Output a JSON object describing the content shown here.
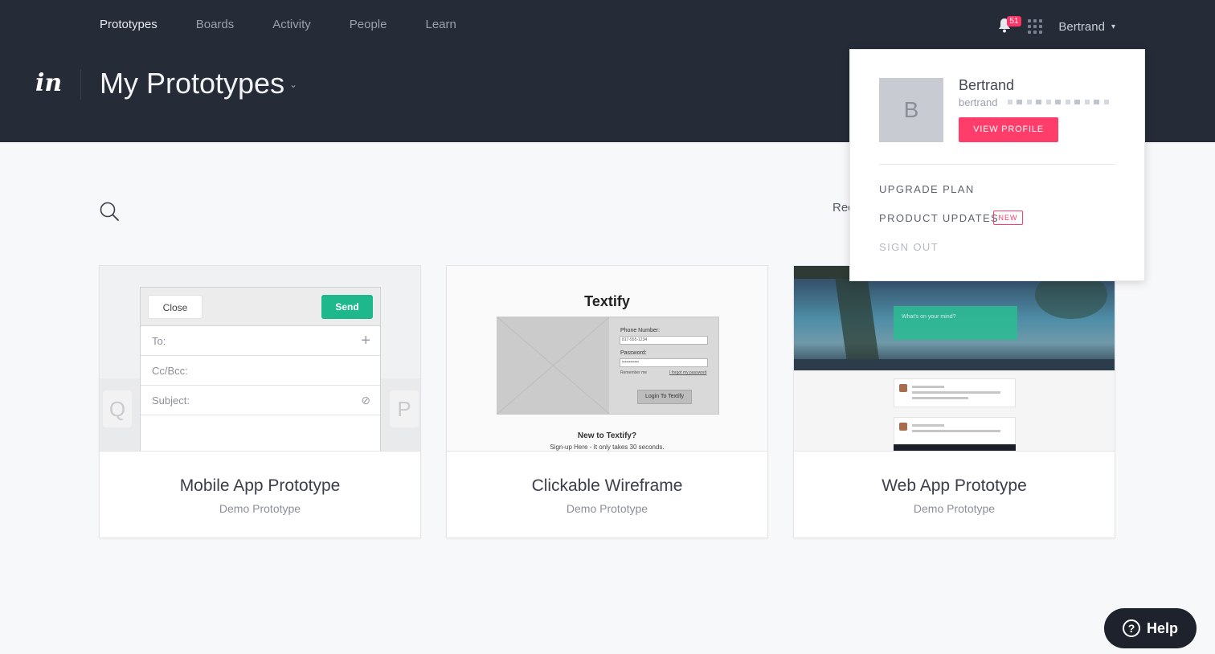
{
  "nav": {
    "items": [
      "Prototypes",
      "Boards",
      "Activity",
      "People",
      "Learn"
    ],
    "active": "Prototypes"
  },
  "notifications": {
    "count": "51"
  },
  "user": {
    "name": "Bertrand",
    "initial": "B",
    "email_prefix": "bertrand"
  },
  "header": {
    "logo_text": "in",
    "title": "My Prototypes"
  },
  "toolbar": {
    "sort_label_partial": "Rec"
  },
  "cards": [
    {
      "title": "Mobile App Prototype",
      "subtitle": "Demo Prototype"
    },
    {
      "title": "Clickable Wireframe",
      "subtitle": "Demo Prototype"
    },
    {
      "title": "Web App Prototype",
      "subtitle": "Demo Prototype"
    }
  ],
  "mobile_thumb": {
    "close": "Close",
    "send": "Send",
    "rows": [
      "To:",
      "Cc/Bcc:",
      "Subject:"
    ],
    "keys": [
      "Q",
      "P"
    ]
  },
  "wireframe_thumb": {
    "title": "Textify",
    "phone_label": "Phone Number:",
    "phone_value": "817-555-1234",
    "password_label": "Password:",
    "password_value": "••••••••••••",
    "remember": "Remember me",
    "forgot": "I forgot my password",
    "login": "Login To Textify",
    "new_to": "New to Textify?",
    "signup": "Sign-up Here - It only takes 30 seconds."
  },
  "webapp_thumb": {
    "cta": "What's on your mind?"
  },
  "dropdown": {
    "view_profile": "VIEW PROFILE",
    "upgrade": "UPGRADE PLAN",
    "product_updates": "PRODUCT UPDATES",
    "new_badge": "NEW",
    "sign_out": "SIGN OUT"
  },
  "help": {
    "label": "Help",
    "icon": "?"
  },
  "colors": {
    "header_bg": "#262b38",
    "accent": "#ff3d6b",
    "send_green": "#1fb88d"
  }
}
